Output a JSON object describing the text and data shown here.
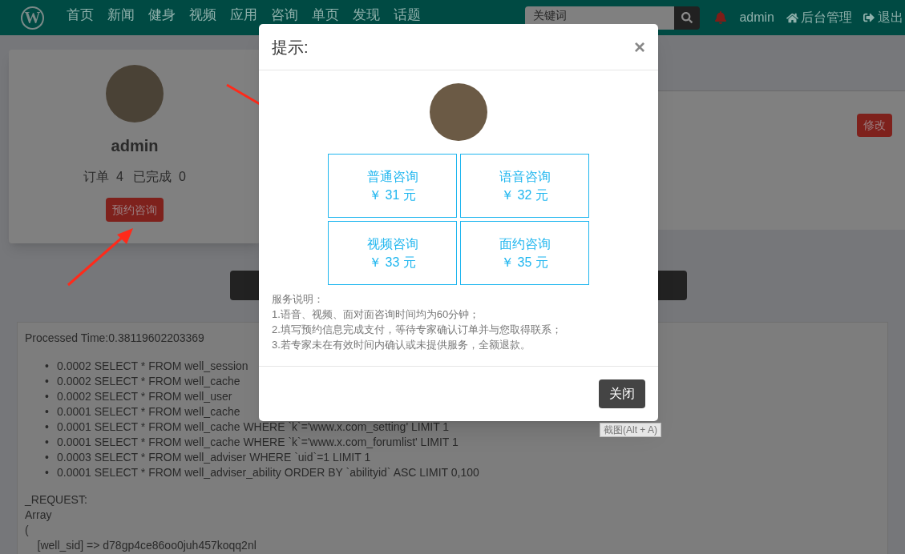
{
  "navbar": {
    "logo_text": "W",
    "items": [
      {
        "label": "首页"
      },
      {
        "label": "新闻"
      },
      {
        "label": "健身"
      },
      {
        "label": "视频"
      },
      {
        "label": "应用"
      },
      {
        "label": "咨询"
      },
      {
        "label": "单页"
      },
      {
        "label": "发现"
      },
      {
        "label": "话题"
      }
    ],
    "search": {
      "placeholder": "关键词"
    },
    "user": "admin",
    "admin_link": "后台管理",
    "logout": "退出"
  },
  "profile_card": {
    "name": "admin",
    "orders_label": "订单",
    "orders": "4",
    "done_label": "已完成",
    "done": "0",
    "book_button": "预约咨询"
  },
  "detail_card": {
    "edit_button": "修改"
  },
  "debug": {
    "processed_time": "Processed Time:0.38119602203369",
    "queries": [
      {
        "bullet": "•",
        "text": "0.0002 SELECT * FROM well_session"
      },
      {
        "bullet": "•",
        "text": "0.0002 SELECT * FROM well_cache"
      },
      {
        "bullet": "•",
        "text": "0.0002 SELECT * FROM well_user"
      },
      {
        "bullet": "•",
        "text": "0.0001 SELECT * FROM well_cache"
      },
      {
        "bullet": "•",
        "text": "0.0001 SELECT * FROM well_cache WHERE `k`='www.x.com_setting' LIMIT 1"
      },
      {
        "bullet": "•",
        "text": "0.0001 SELECT * FROM well_cache WHERE `k`='www.x.com_forumlist' LIMIT 1"
      },
      {
        "bullet": "•",
        "text": "0.0003 SELECT * FROM well_adviser WHERE `uid`=1 LIMIT 1"
      },
      {
        "bullet": "•",
        "text": "0.0001 SELECT * FROM well_adviser_ability ORDER BY `abilityid` ASC LIMIT 0,100"
      }
    ],
    "request_lines": [
      "_REQUEST:",
      "Array",
      "(",
      "    [well_sid] => d78gp4ce86oo0juh457koqq2nl"
    ]
  },
  "dialog": {
    "title": "提示:",
    "close_x": "×",
    "options": [
      {
        "name": "普通咨询",
        "price": "￥ 31 元"
      },
      {
        "name": "语音咨询",
        "price": "￥ 32 元"
      },
      {
        "name": "视频咨询",
        "price": "￥ 33 元"
      },
      {
        "name": "面约咨询",
        "price": "￥ 35 元"
      }
    ],
    "notes": [
      "服务说明：",
      "1.语音、视频、面对面咨询时间均为60分钟；",
      "2.填写预约信息完成支付，等待专家确认订单并与您取得联系；",
      "3.若专家未在有效时间内确认或未提供服务，全额退款。"
    ],
    "close_button": "关闭"
  },
  "tooltip": "截图(Alt + A)"
}
